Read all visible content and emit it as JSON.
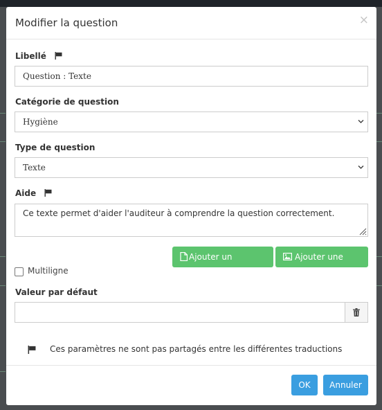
{
  "modal": {
    "title": "Modifier la question",
    "close_symbol": "×"
  },
  "form": {
    "libelle": {
      "label": "Libellé",
      "value": "Question : Texte",
      "icon": "flag-icon"
    },
    "categorie": {
      "label": "Catégorie de question",
      "value": "Hygiène"
    },
    "type": {
      "label": "Type de question",
      "value": "Texte"
    },
    "aide": {
      "label": "Aide",
      "value": "Ce texte permet d'aider l'auditeur à comprendre la question correctement.",
      "icon": "flag-icon"
    },
    "buttons": {
      "add_document": "Ajouter un document",
      "add_photo": "Ajouter une photo"
    },
    "multiligne": {
      "label": "Multiligne",
      "checked": false
    },
    "valeur_defaut": {
      "label": "Valeur par défaut",
      "value": ""
    },
    "notice": "Ces paramètres ne sont pas partagés entre les différentes traductions"
  },
  "footer": {
    "ok_label": "OK",
    "cancel_label": "Annuler"
  },
  "colors": {
    "green": "#5cc46e",
    "blue": "#3a9ee0",
    "backdrop": "#4a4d50"
  }
}
